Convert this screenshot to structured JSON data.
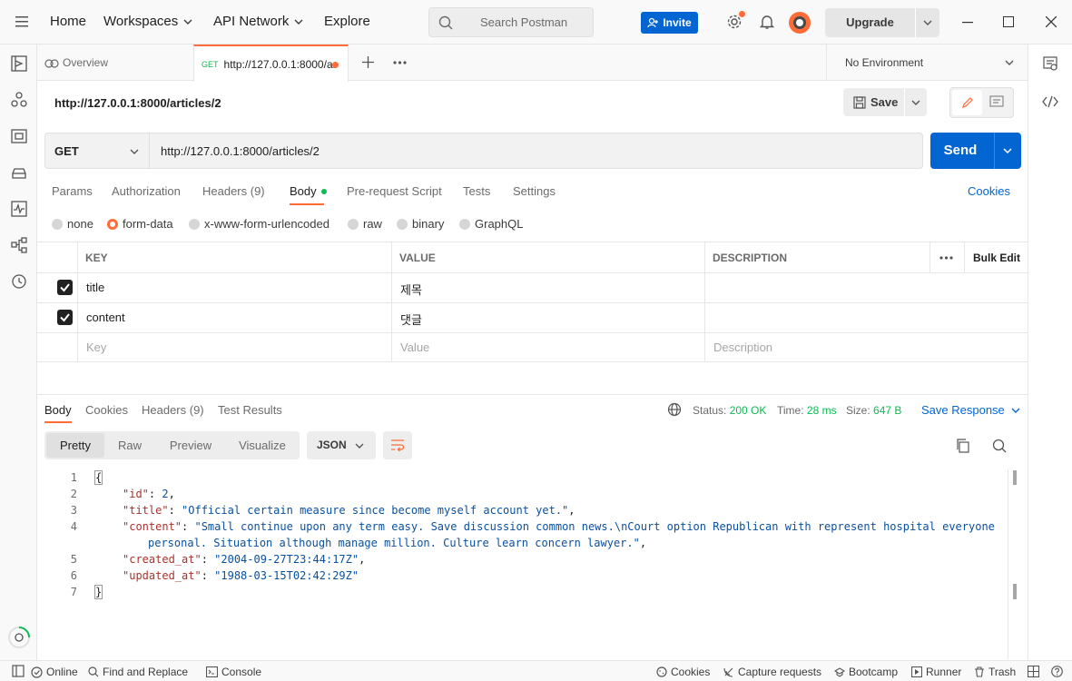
{
  "titlebar": {
    "nav": [
      "Home",
      "Workspaces",
      "API Network",
      "Explore"
    ],
    "search_placeholder": "Search Postman",
    "invite_label": "Invite",
    "upgrade_label": "Upgrade"
  },
  "tabs": {
    "overview_label": "Overview",
    "active_method": "GET",
    "active_label": "http://127.0.0.1:8000/ar",
    "environment": "No Environment"
  },
  "request": {
    "name": "http://127.0.0.1:8000/articles/2",
    "save_label": "Save",
    "method": "GET",
    "url": "http://127.0.0.1:8000/articles/2",
    "send_label": "Send",
    "tabs": [
      "Params",
      "Authorization",
      "Headers (9)",
      "Body",
      "Pre-request Script",
      "Tests",
      "Settings"
    ],
    "cookies_label": "Cookies",
    "body_types": [
      "none",
      "form-data",
      "x-www-form-urlencoded",
      "raw",
      "binary",
      "GraphQL"
    ],
    "selected_body_type": "form-data",
    "table": {
      "headers": [
        "KEY",
        "VALUE",
        "DESCRIPTION"
      ],
      "bulk_edit": "Bulk Edit",
      "rows": [
        {
          "checked": true,
          "key": "title",
          "value": "제목",
          "description": ""
        },
        {
          "checked": true,
          "key": "content",
          "value": "댓글",
          "description": ""
        }
      ],
      "placeholders": {
        "key": "Key",
        "value": "Value",
        "description": "Description"
      }
    }
  },
  "response": {
    "tabs": [
      "Body",
      "Cookies",
      "Headers (9)",
      "Test Results"
    ],
    "status_label": "Status:",
    "status_value": "200 OK",
    "time_label": "Time:",
    "time_value": "28 ms",
    "size_label": "Size:",
    "size_value": "647 B",
    "save_response": "Save Response",
    "views": [
      "Pretty",
      "Raw",
      "Preview",
      "Visualize"
    ],
    "format": "JSON",
    "body": {
      "id": "2",
      "title": "\"Official certain measure since become myself account yet.\"",
      "content_line1": "\"Small continue upon any term easy. Save discussion common news.\\nCourt option Republican with represent hospital everyone",
      "content_line2": "personal. Situation although manage million. Culture learn concern lawyer.\"",
      "created_at": "\"2004-09-27T23:44:17Z\"",
      "updated_at": "\"1988-03-15T02:42:29Z\""
    },
    "line_numbers": [
      "1",
      "2",
      "3",
      "4",
      "5",
      "6",
      "7"
    ]
  },
  "statusbar": {
    "online": "Online",
    "find_replace": "Find and Replace",
    "console": "Console",
    "cookies": "Cookies",
    "capture": "Capture requests",
    "bootcamp": "Bootcamp",
    "runner": "Runner",
    "trash": "Trash"
  },
  "colors": {
    "accent": "#ff6c37",
    "primary": "#0265d2",
    "success": "#0cbb52"
  }
}
